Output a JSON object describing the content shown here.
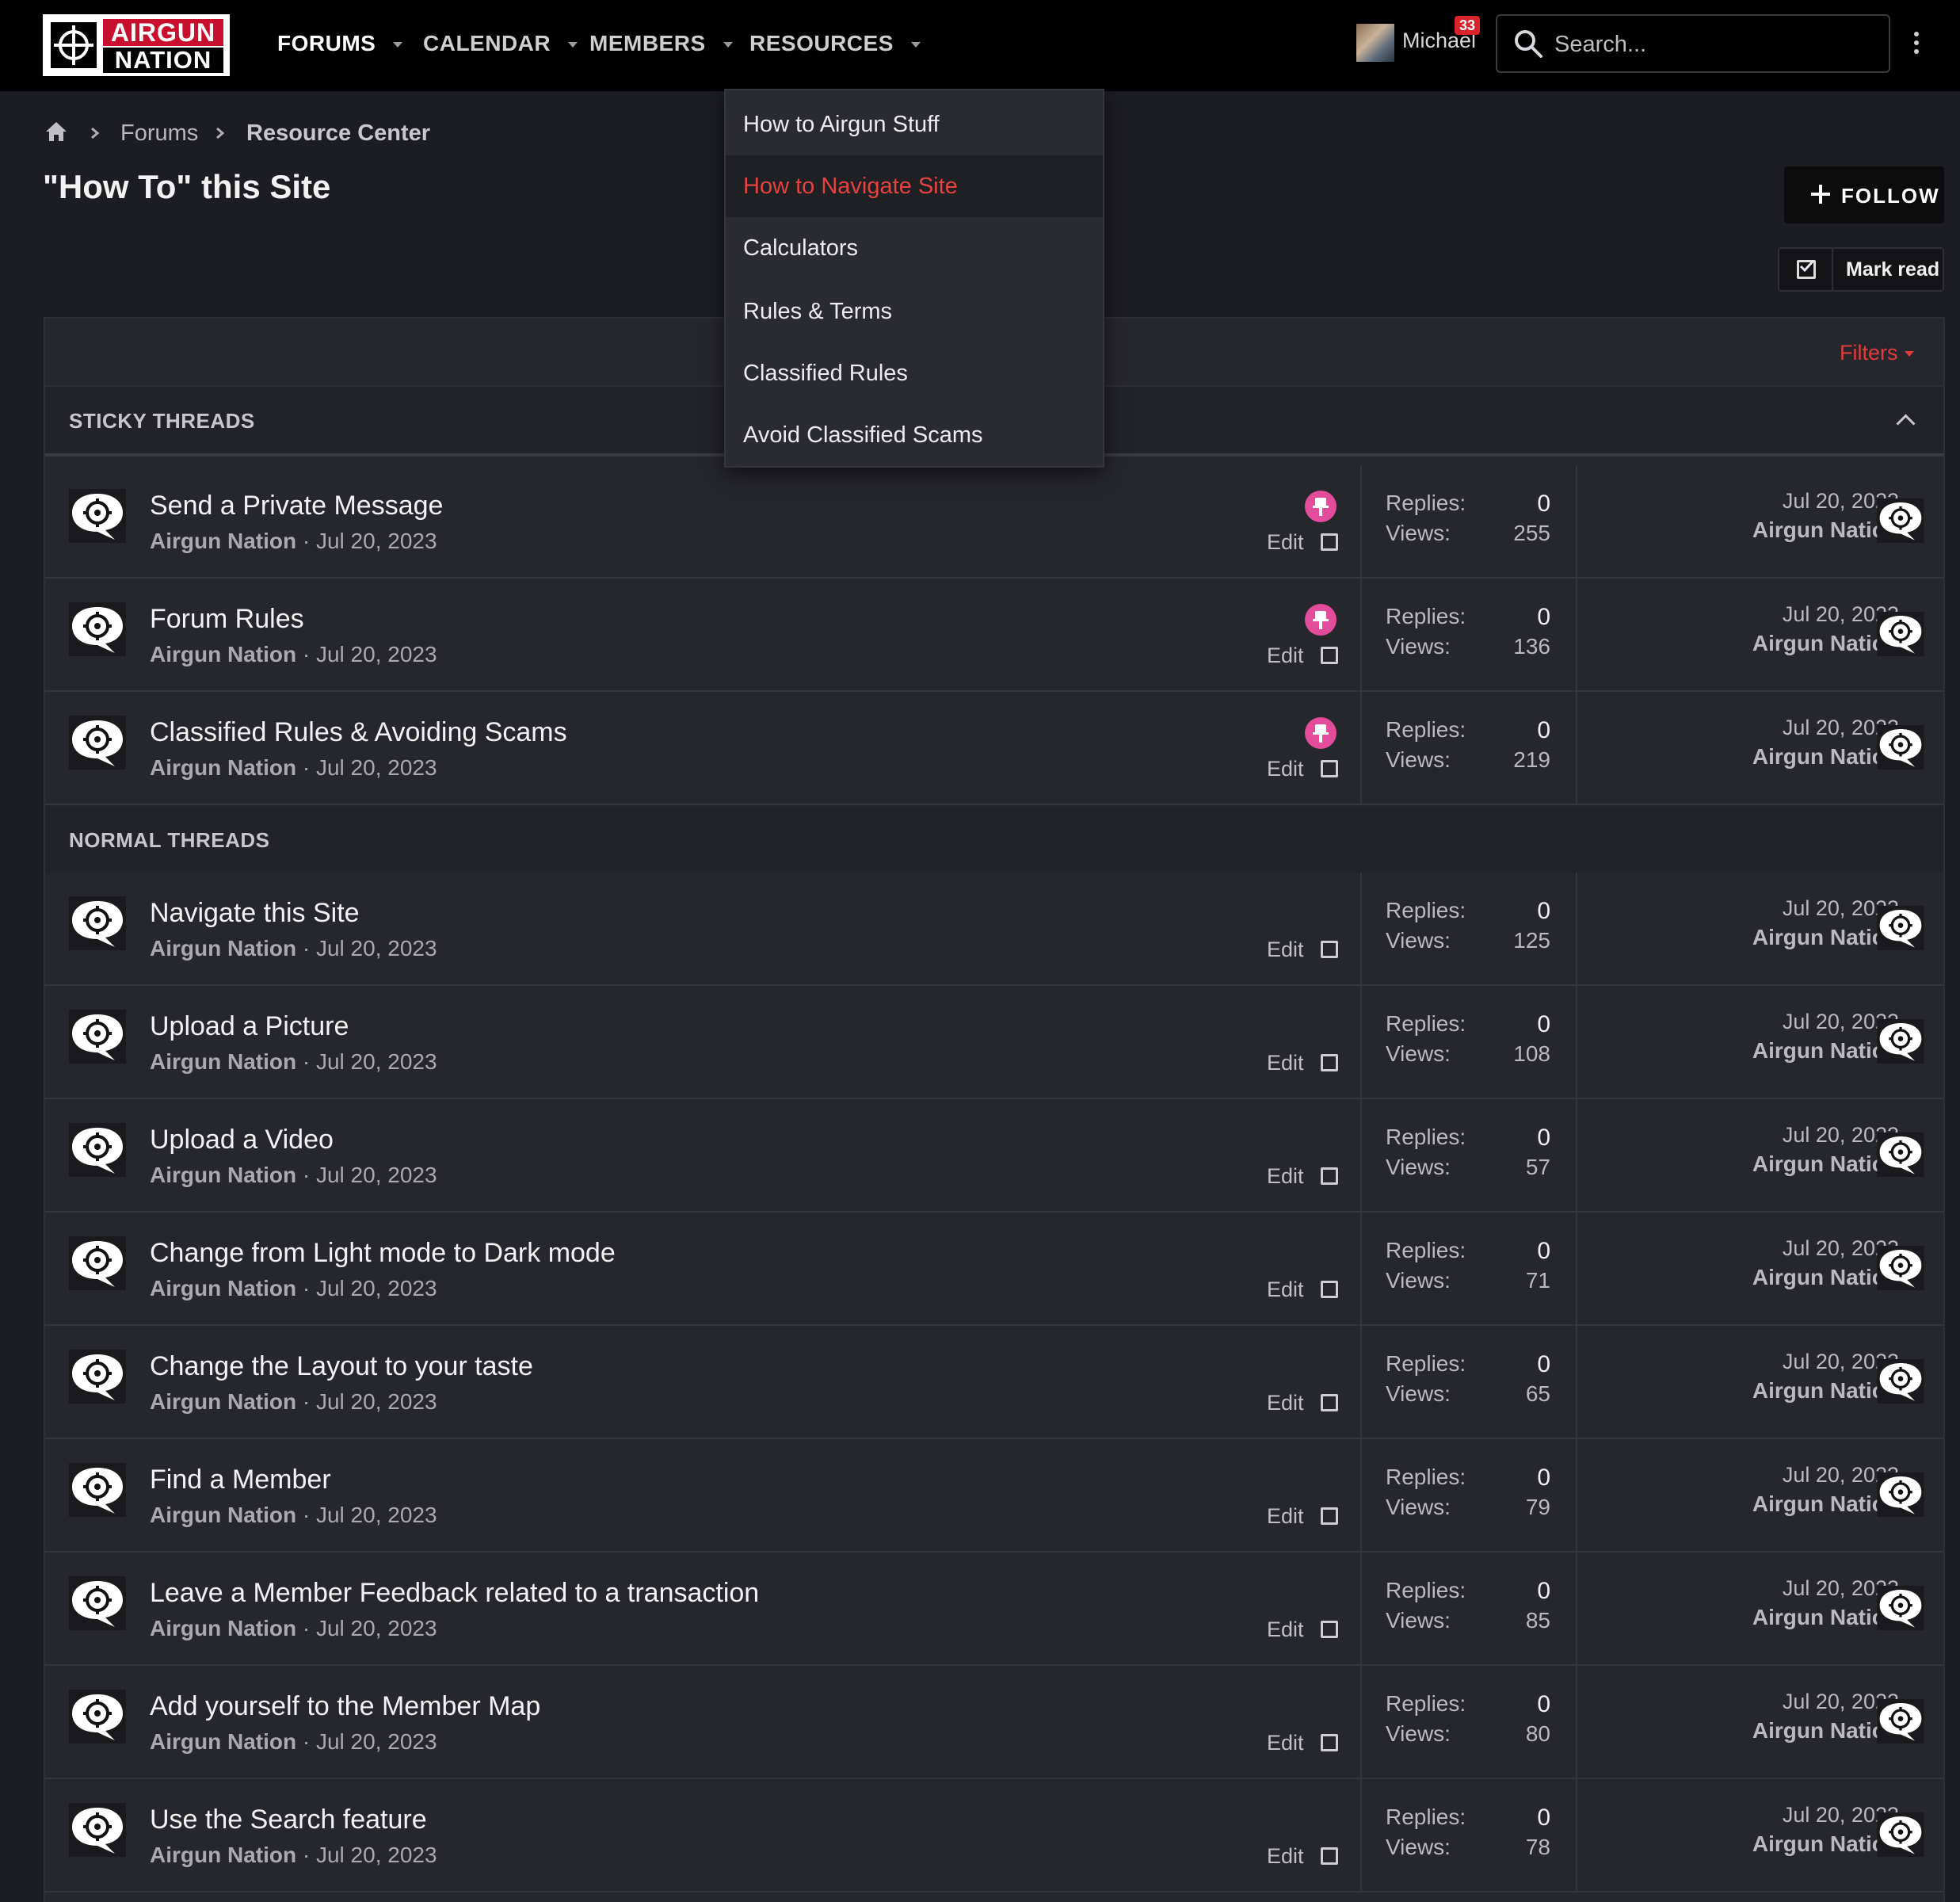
{
  "brand": {
    "line1": "AIRGUN",
    "line2": "NATION"
  },
  "nav": {
    "tabs": [
      {
        "label": "FORUMS",
        "active": true
      },
      {
        "label": "CALENDAR",
        "active": false
      },
      {
        "label": "MEMBERS",
        "active": false
      },
      {
        "label": "RESOURCES",
        "active": false
      }
    ],
    "user": {
      "name": "Michael",
      "alerts": "33"
    },
    "search_placeholder": "Search..."
  },
  "breadcrumb": [
    "Forums",
    "Resource Center"
  ],
  "page_title": "\"How To\" this Site",
  "actions": {
    "follow": "FOLLOW",
    "mark_read": "Mark read",
    "filters": "Filters"
  },
  "resources_menu": [
    {
      "label": "How to Airgun Stuff",
      "highlighted": false
    },
    {
      "label": "How to Navigate Site",
      "highlighted": true
    },
    {
      "label": "Calculators",
      "highlighted": false
    },
    {
      "label": "Rules & Terms",
      "highlighted": false
    },
    {
      "label": "Classified Rules",
      "highlighted": false
    },
    {
      "label": "Avoid Classified Scams",
      "highlighted": false
    }
  ],
  "labels": {
    "replies": "Replies:",
    "views": "Views:",
    "edit": "Edit"
  },
  "sticky": {
    "header": "STICKY THREADS",
    "threads": [
      {
        "title": "Send a Private Message",
        "author": "Airgun Nation",
        "date": "Jul 20, 2023",
        "replies": "0",
        "views": "255",
        "last_date": "Jul 20, 2023",
        "last_user": "Airgun Nation"
      },
      {
        "title": "Forum Rules",
        "author": "Airgun Nation",
        "date": "Jul 20, 2023",
        "replies": "0",
        "views": "136",
        "last_date": "Jul 20, 2023",
        "last_user": "Airgun Nation"
      },
      {
        "title": "Classified Rules & Avoiding Scams",
        "author": "Airgun Nation",
        "date": "Jul 20, 2023",
        "replies": "0",
        "views": "219",
        "last_date": "Jul 20, 2023",
        "last_user": "Airgun Nation"
      }
    ]
  },
  "normal": {
    "header": "NORMAL THREADS",
    "threads": [
      {
        "title": "Navigate this Site",
        "author": "Airgun Nation",
        "date": "Jul 20, 2023",
        "replies": "0",
        "views": "125",
        "last_date": "Jul 20, 2023",
        "last_user": "Airgun Nation"
      },
      {
        "title": "Upload a Picture",
        "author": "Airgun Nation",
        "date": "Jul 20, 2023",
        "replies": "0",
        "views": "108",
        "last_date": "Jul 20, 2023",
        "last_user": "Airgun Nation"
      },
      {
        "title": "Upload a Video",
        "author": "Airgun Nation",
        "date": "Jul 20, 2023",
        "replies": "0",
        "views": "57",
        "last_date": "Jul 20, 2023",
        "last_user": "Airgun Nation"
      },
      {
        "title": "Change from Light mode to Dark mode",
        "author": "Airgun Nation",
        "date": "Jul 20, 2023",
        "replies": "0",
        "views": "71",
        "last_date": "Jul 20, 2023",
        "last_user": "Airgun Nation"
      },
      {
        "title": "Change the Layout to your taste",
        "author": "Airgun Nation",
        "date": "Jul 20, 2023",
        "replies": "0",
        "views": "65",
        "last_date": "Jul 20, 2023",
        "last_user": "Airgun Nation"
      },
      {
        "title": "Find a Member",
        "author": "Airgun Nation",
        "date": "Jul 20, 2023",
        "replies": "0",
        "views": "79",
        "last_date": "Jul 20, 2023",
        "last_user": "Airgun Nation"
      },
      {
        "title": "Leave a Member Feedback related to a transaction",
        "author": "Airgun Nation",
        "date": "Jul 20, 2023",
        "replies": "0",
        "views": "85",
        "last_date": "Jul 20, 2023",
        "last_user": "Airgun Nation"
      },
      {
        "title": "Add yourself to the Member Map",
        "author": "Airgun Nation",
        "date": "Jul 20, 2023",
        "replies": "0",
        "views": "80",
        "last_date": "Jul 20, 2023",
        "last_user": "Airgun Nation"
      },
      {
        "title": "Use the Search feature",
        "author": "Airgun Nation",
        "date": "Jul 20, 2023",
        "replies": "0",
        "views": "78",
        "last_date": "Jul 20, 2023",
        "last_user": "Airgun Nation"
      }
    ]
  },
  "colors": {
    "accent_red": "#e4433f",
    "pin_pink": "#e34b9b",
    "nav_bg": "#000000",
    "page_bg": "#1c1d20"
  },
  "icons": [
    "home-icon",
    "chevron-right-icon",
    "search-icon",
    "kebab-menu-icon",
    "plus-icon",
    "mark-read-icon",
    "chevron-up-icon",
    "pin-icon",
    "checkbox-icon",
    "airgun-nation-avatar-icon"
  ]
}
